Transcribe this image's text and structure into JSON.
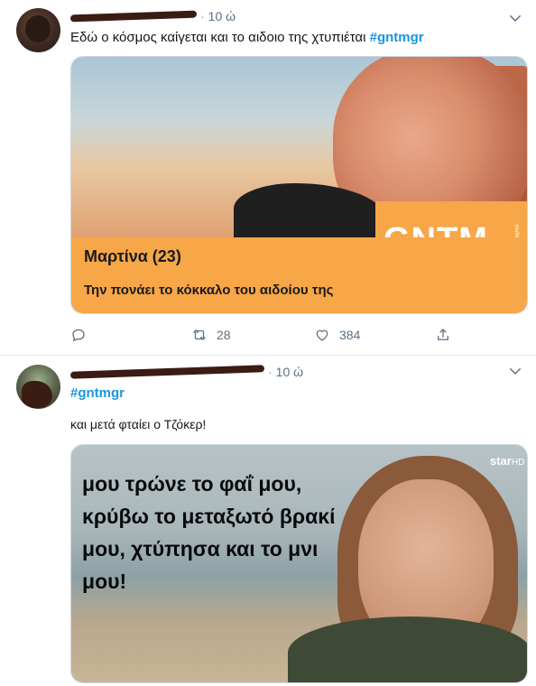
{
  "tweets": [
    {
      "time": "10 ώ",
      "text": "Εδώ ο κόσμος καίγεται και το αιδοιο της χτυπιέται",
      "hashtag": "#gntmgr",
      "media": {
        "logo": "GNTM",
        "logo_sub": "multimedia",
        "title": "Μαρτίνα (23)",
        "caption": "Την πονάει το κόκκαλο του αιδοίου της"
      },
      "actions": {
        "reply_count": "",
        "retweet_count": "28",
        "like_count": "384"
      },
      "icons": [
        "chevron-down-icon",
        "reply-icon",
        "retweet-icon",
        "like-icon",
        "share-icon"
      ]
    },
    {
      "time": "10 ώ",
      "hashtag": "#gntmgr",
      "text": "και μετά φταίει ο Τζόκερ!",
      "media": {
        "channel": "star",
        "channel_suffix": "HD",
        "quote": "μου τρώνε το φαΐ μου, κρύβω το μεταξωτό βρακί μου, χτύπησα και το μνι μου!"
      },
      "icons": [
        "chevron-down-icon"
      ]
    }
  ],
  "colors": {
    "accent": "#1b95e0",
    "secondary_text": "#5b7083",
    "gntm_orange": "#f7a648"
  }
}
